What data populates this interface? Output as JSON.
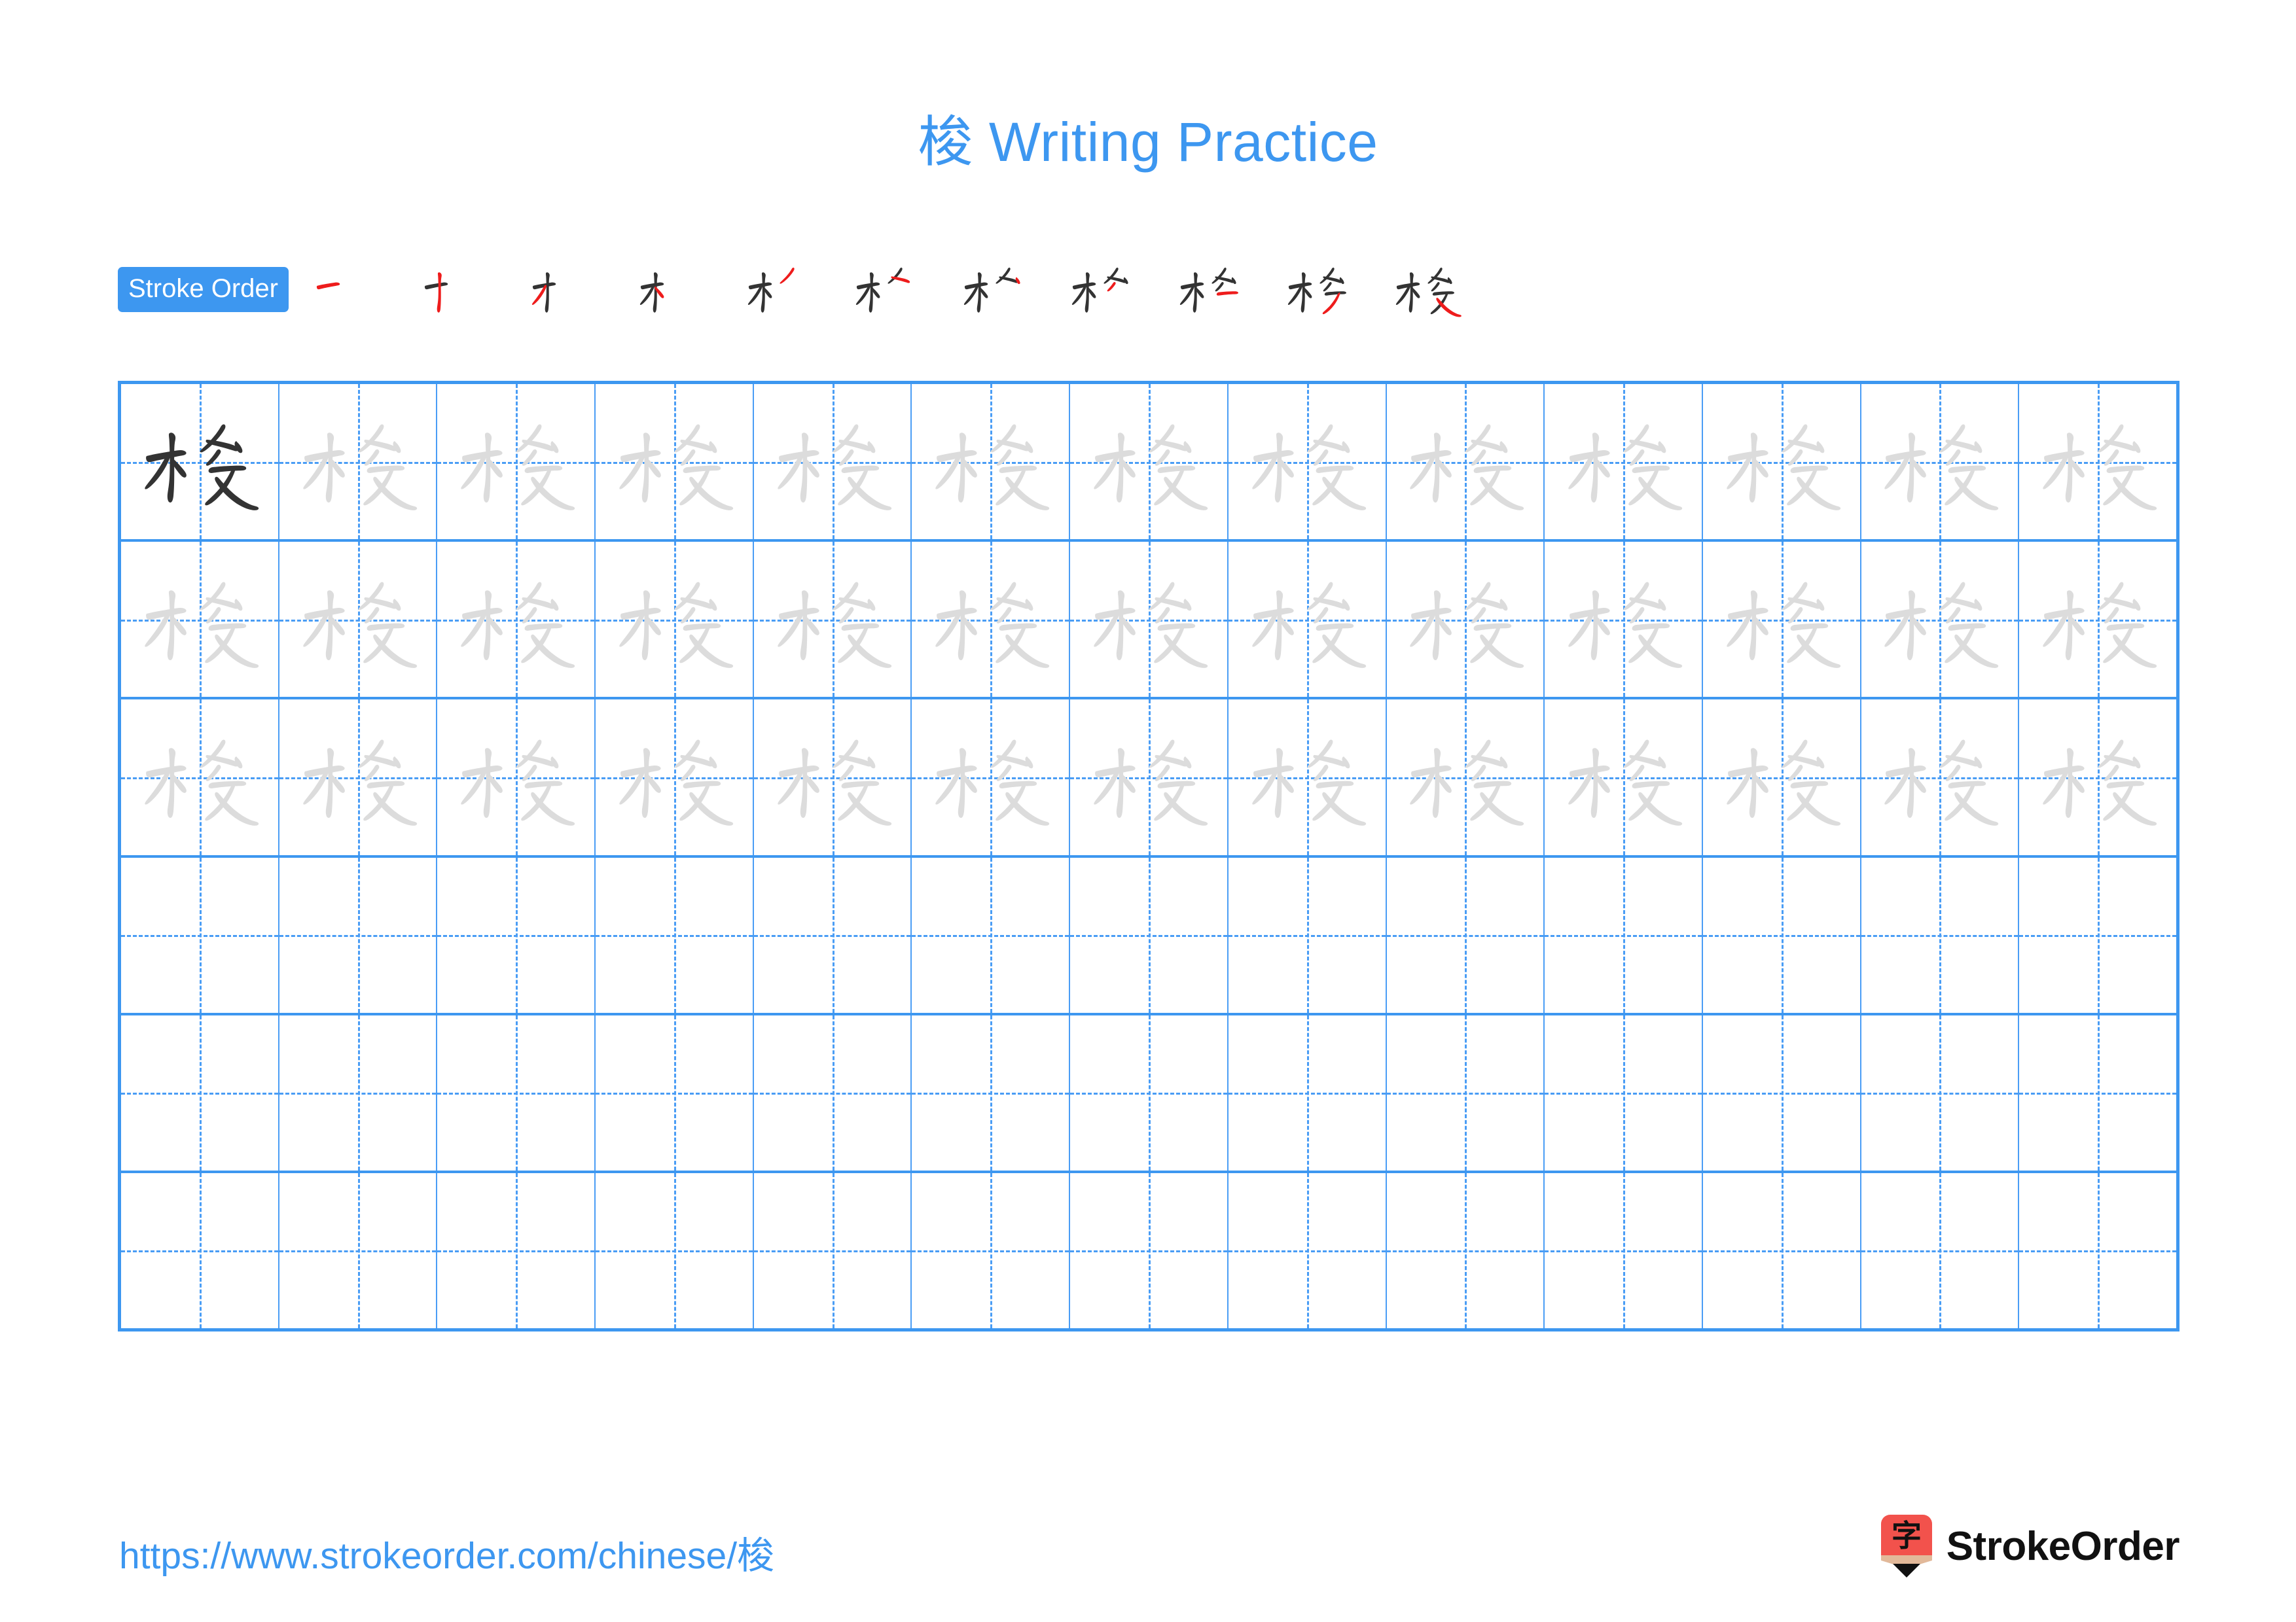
{
  "document": {
    "type": "chinese-character-writing-practice-worksheet",
    "character": "梭",
    "title_text": "梭 Writing Practice",
    "title_character": "梭",
    "title_suffix": " Writing Practice",
    "page_background": "#ffffff"
  },
  "colors": {
    "accent_blue": "#3d97f0",
    "grid_line_blue": "#4a9df5",
    "trace_gray": "#dcdcdc",
    "ink_dark": "#333333",
    "new_stroke_red": "#ee1c1c",
    "logo_red": "#f2524c",
    "logo_wood": "#e2b99a",
    "logo_tip": "#111111",
    "brand_text": "#111111"
  },
  "stroke_order": {
    "badge_label": "Stroke Order",
    "total_strokes": 11,
    "steps": [
      {
        "index": 1,
        "new_stroke_name": "heng"
      },
      {
        "index": 2,
        "new_stroke_name": "shu"
      },
      {
        "index": 3,
        "new_stroke_name": "pie"
      },
      {
        "index": 4,
        "new_stroke_name": "dian"
      },
      {
        "index": 5,
        "new_stroke_name": "pie"
      },
      {
        "index": 6,
        "new_stroke_name": "dian"
      },
      {
        "index": 7,
        "new_stroke_name": "pie"
      },
      {
        "index": 8,
        "new_stroke_name": "dian"
      },
      {
        "index": 9,
        "new_stroke_name": "pie"
      },
      {
        "index": 10,
        "new_stroke_name": "heng-pie"
      },
      {
        "index": 11,
        "new_stroke_name": "na"
      }
    ]
  },
  "practice_grid": {
    "columns": 13,
    "rows": 6,
    "guide_style": "dashed-cross",
    "rows_content": [
      {
        "row": 1,
        "cells": [
          "dark",
          "trace",
          "trace",
          "trace",
          "trace",
          "trace",
          "trace",
          "trace",
          "trace",
          "trace",
          "trace",
          "trace",
          "trace"
        ]
      },
      {
        "row": 2,
        "cells": [
          "trace",
          "trace",
          "trace",
          "trace",
          "trace",
          "trace",
          "trace",
          "trace",
          "trace",
          "trace",
          "trace",
          "trace",
          "trace"
        ]
      },
      {
        "row": 3,
        "cells": [
          "trace",
          "trace",
          "trace",
          "trace",
          "trace",
          "trace",
          "trace",
          "trace",
          "trace",
          "trace",
          "trace",
          "trace",
          "trace"
        ]
      },
      {
        "row": 4,
        "cells": [
          "empty",
          "empty",
          "empty",
          "empty",
          "empty",
          "empty",
          "empty",
          "empty",
          "empty",
          "empty",
          "empty",
          "empty",
          "empty"
        ]
      },
      {
        "row": 5,
        "cells": [
          "empty",
          "empty",
          "empty",
          "empty",
          "empty",
          "empty",
          "empty",
          "empty",
          "empty",
          "empty",
          "empty",
          "empty",
          "empty"
        ]
      },
      {
        "row": 6,
        "cells": [
          "empty",
          "empty",
          "empty",
          "empty",
          "empty",
          "empty",
          "empty",
          "empty",
          "empty",
          "empty",
          "empty",
          "empty",
          "empty"
        ]
      }
    ]
  },
  "footer": {
    "url_text": "https://www.strokeorder.com/chinese/梭",
    "url_prefix": "https://www.strokeorder.com/chinese/",
    "url_character": "梭",
    "brand_name": "StrokeOrder",
    "logo_glyph": "字"
  }
}
